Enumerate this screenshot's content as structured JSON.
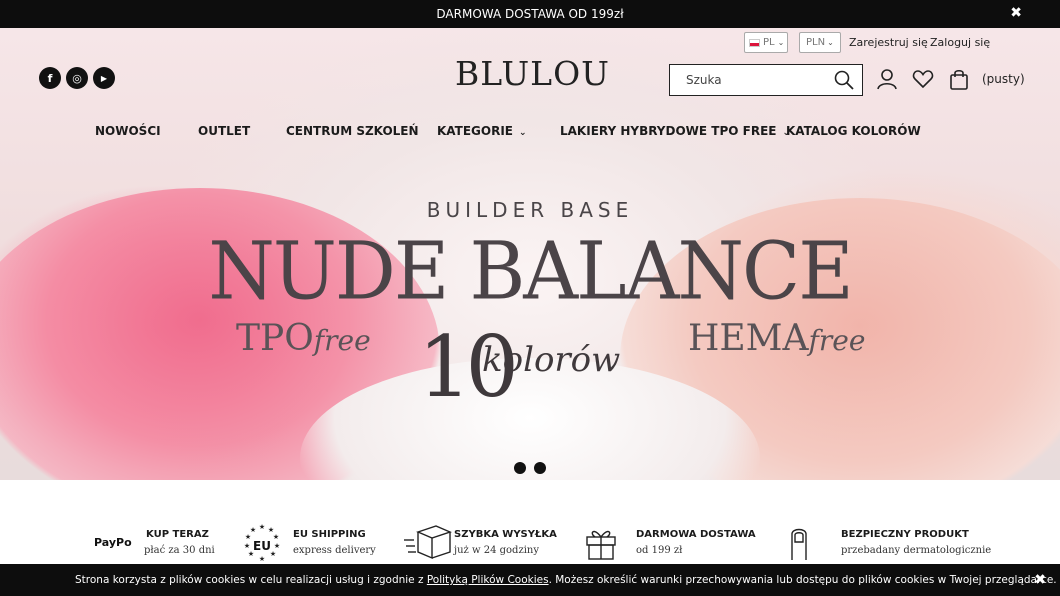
{
  "topbar": {
    "text": "DARMOWA DOSTAWA OD 199zł",
    "close_icon": "✖"
  },
  "header": {
    "language": "PL",
    "currency": "PLN",
    "register": "Zarejestruj się",
    "login": "Zaloguj się",
    "logo": "BLULOU",
    "search_placeholder": "Szuka",
    "cart_label": "(pusty)"
  },
  "social": [
    {
      "icon": "facebook-icon",
      "glyph": "f"
    },
    {
      "icon": "instagram-icon",
      "glyph": "◎"
    },
    {
      "icon": "youtube-icon",
      "glyph": "▶"
    }
  ],
  "nav": {
    "items": [
      {
        "label": "NOWOŚCI",
        "dropdown": false
      },
      {
        "label": "OUTLET",
        "dropdown": false
      },
      {
        "label": "CENTRUM SZKOLEŃ",
        "dropdown": false
      },
      {
        "label": "KATEGORIE",
        "dropdown": true
      },
      {
        "label": "LAKIERY HYBRYDOWE TPO FREE",
        "dropdown": true
      },
      {
        "label": "KATALOG KOLORÓW",
        "dropdown": false
      }
    ]
  },
  "hero": {
    "subtitle": "BUILDER BASE",
    "title": "NUDE BALANCE",
    "tpo": "TPO",
    "tpo_free": "free",
    "ten": "10",
    "kolorow": "kolorów",
    "hema": "HEMA",
    "hema_free": "free",
    "slides": 2,
    "active_slide": 1
  },
  "features": [
    {
      "icon": "paypo-logo",
      "title": "KUP TERAZ",
      "subtitle": "płać za 30 dni",
      "logo_text": "PayPo"
    },
    {
      "icon": "eu-stars-icon",
      "title": "EU SHIPPING",
      "subtitle": "express delivery",
      "logo_text": "EU"
    },
    {
      "icon": "delivery-box-icon",
      "title": "SZYBKA WYSYŁKA",
      "subtitle": "już w 24 godziny"
    },
    {
      "icon": "gift-icon",
      "title": "DARMOWA DOSTAWA",
      "subtitle": "od 199 zł"
    },
    {
      "icon": "nail-icon",
      "title": "BEZPIECZNY PRODUKT",
      "subtitle": "przebadany dermatologicznie"
    }
  ],
  "cookie": {
    "text_before": "Strona korzysta z plików cookies w celu realizacji usług i zgodnie z ",
    "link": "Polityką Plików Cookies",
    "text_after": ". Możesz określić warunki przechowywania lub dostępu do plików cookies w Twojej przeglądarce.",
    "close_icon": "✖"
  }
}
